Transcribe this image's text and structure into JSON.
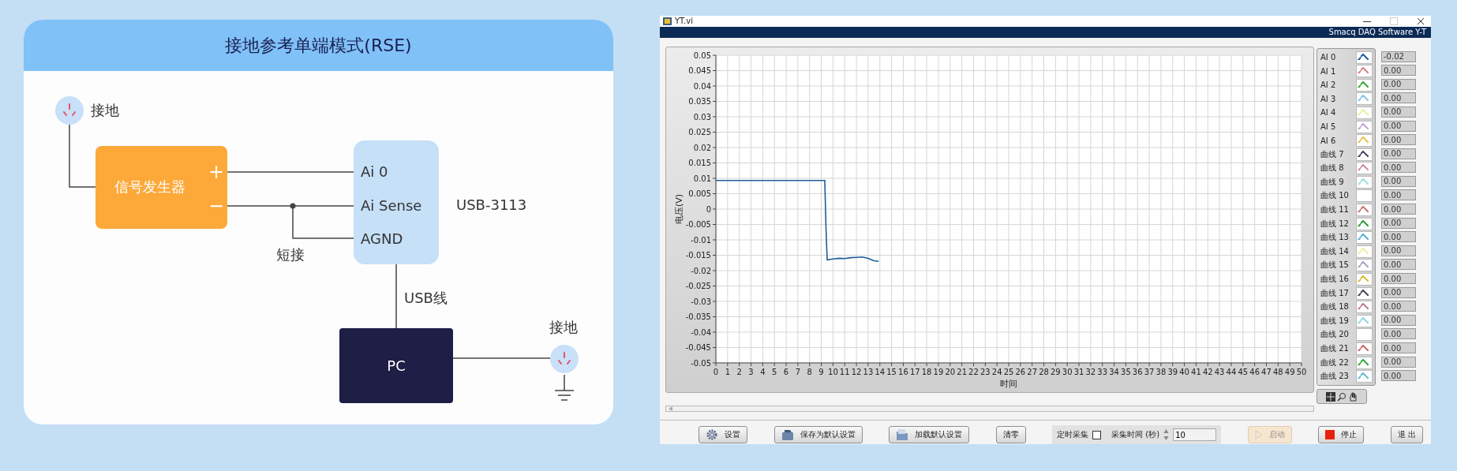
{
  "diagram": {
    "title": "接地参考单端模式(RSE)",
    "ground_labels": [
      "接地",
      "接地"
    ],
    "signal_generator": {
      "label": "信号发生器",
      "plus": "+",
      "minus": "−"
    },
    "device": {
      "pins": [
        "Ai 0",
        "Ai Sense",
        "AGND"
      ],
      "model": "USB-3113"
    },
    "short_label": "短接",
    "usb_label": "USB线",
    "pc": {
      "label": "PC"
    }
  },
  "window": {
    "title": "YT.vi",
    "banner": "Smacq DAQ Software Y-T"
  },
  "chart": {
    "chart_data": {
      "type": "line",
      "xlabel": "时间",
      "ylabel": "电压(V)",
      "xlim": [
        0,
        50
      ],
      "ylim": [
        -0.05,
        0.05
      ],
      "xticks": [
        0,
        1,
        2,
        3,
        4,
        5,
        6,
        7,
        8,
        9,
        10,
        11,
        12,
        13,
        14,
        15,
        16,
        17,
        18,
        19,
        20,
        21,
        22,
        23,
        24,
        25,
        26,
        27,
        28,
        29,
        30,
        31,
        32,
        33,
        34,
        35,
        36,
        37,
        38,
        39,
        40,
        41,
        42,
        43,
        44,
        45,
        46,
        47,
        48,
        49,
        50
      ],
      "yticks": [
        0.05,
        0.045,
        0.04,
        0.035,
        0.03,
        0.025,
        0.02,
        0.015,
        0.01,
        0.005,
        0,
        -0.005,
        -0.01,
        -0.015,
        -0.02,
        -0.025,
        -0.03,
        -0.035,
        -0.04,
        -0.045,
        -0.05
      ],
      "x": [
        0,
        9.3,
        9.4,
        9.5,
        10,
        10.5,
        11,
        11.5,
        12,
        12.5,
        13,
        13.5,
        13.9
      ],
      "grid": true,
      "series": [
        {
          "color": "#1f5c99",
          "values": [
            0.0093,
            0.0093,
            -0.006,
            -0.0165,
            -0.0162,
            -0.016,
            -0.0161,
            -0.0158,
            -0.0157,
            -0.0156,
            -0.016,
            -0.0168,
            -0.017
          ]
        }
      ]
    }
  },
  "legend": [
    {
      "name": "AI 0",
      "color": "#2a64a8",
      "value": "-0.02"
    },
    {
      "name": "AI 1",
      "color": "#e08a8a",
      "value": "0.00"
    },
    {
      "name": "AI 2",
      "color": "#3cb043",
      "value": "0.00"
    },
    {
      "name": "AI 3",
      "color": "#8cc8e8",
      "value": "0.00"
    },
    {
      "name": "AI 4",
      "color": "#eeeea8",
      "value": "0.00"
    },
    {
      "name": "AI 5",
      "color": "#c4a8d8",
      "value": "0.00"
    },
    {
      "name": "AI 6",
      "color": "#e6c85a",
      "value": "0.00"
    },
    {
      "name": "曲线 7",
      "color": "#505070",
      "value": "0.00"
    },
    {
      "name": "曲线 8",
      "color": "#d890a4",
      "value": "0.00"
    },
    {
      "name": "曲线 9",
      "color": "#a4e0e0",
      "value": "0.00"
    },
    {
      "name": "曲线 10",
      "value": "0.00"
    },
    {
      "name": "曲线 11",
      "color": "#d07c7c",
      "value": "0.00"
    },
    {
      "name": "曲线 12",
      "color": "#3ca040",
      "value": "0.00"
    },
    {
      "name": "曲线 13",
      "color": "#64b4d4",
      "value": "0.00"
    },
    {
      "name": "曲线 14",
      "color": "#eeeea8",
      "value": "0.00"
    },
    {
      "name": "曲线 15",
      "color": "#b4a4c4",
      "value": "0.00"
    },
    {
      "name": "曲线 16",
      "color": "#e0c040",
      "value": "0.00"
    },
    {
      "name": "曲线 17",
      "color": "#505060",
      "value": "0.00"
    },
    {
      "name": "曲线 18",
      "color": "#c08494",
      "value": "0.00"
    },
    {
      "name": "曲线 19",
      "color": "#94d8e0",
      "value": "0.00"
    },
    {
      "name": "曲线 20",
      "value": "0.00"
    },
    {
      "name": "曲线 21",
      "color": "#d07070",
      "value": "0.00"
    },
    {
      "name": "曲线 22",
      "color": "#3cb043",
      "value": "0.00"
    },
    {
      "name": "曲线 23",
      "color": "#74c0d4",
      "value": "0.00"
    }
  ],
  "buttons": [
    {
      "label": "设置",
      "kind": "gear",
      "disabled": false
    },
    {
      "label": "保存为默认设置",
      "kind": "save",
      "disabled": false
    },
    {
      "label": "加载默认设置",
      "kind": "load",
      "disabled": false
    },
    {
      "label": "清零",
      "kind": "plain",
      "disabled": false
    },
    {
      "kind": "acquisition"
    },
    {
      "label": "启动",
      "kind": "start",
      "disabled": true
    },
    {
      "label": "停止",
      "kind": "stop",
      "disabled": false
    },
    {
      "label": "退 出",
      "kind": "plain",
      "disabled": false
    }
  ],
  "acquisition": {
    "timed_label": "定时采集",
    "timed_checked": false,
    "time_label": "采集时间 (秒)",
    "time_value": "10"
  }
}
